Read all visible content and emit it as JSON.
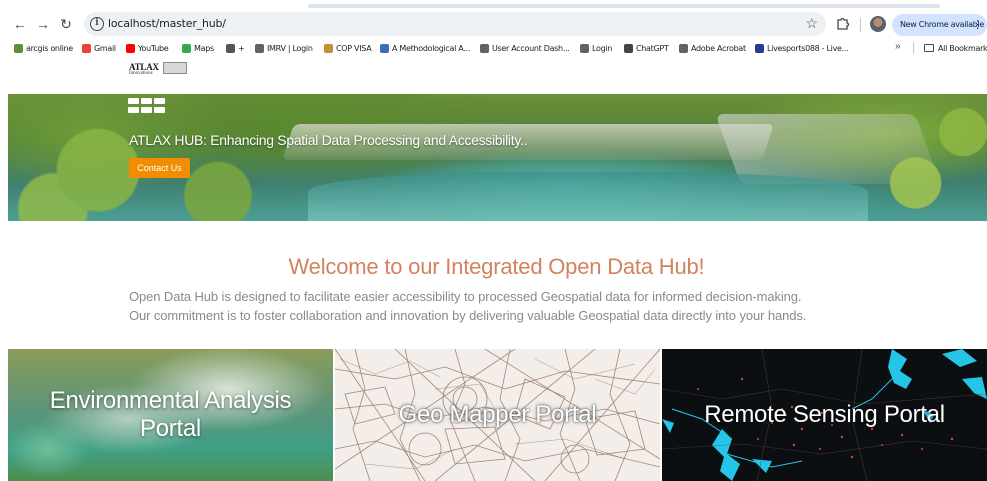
{
  "browser": {
    "url": "localhost/master_hub/",
    "update_label": "New Chrome available",
    "bookmarks": [
      {
        "label": "arcgis online",
        "color": "#5b8f3a"
      },
      {
        "label": "Gmail",
        "color": "#ea4335"
      },
      {
        "label": "YouTube",
        "color": "#ff0000"
      },
      {
        "label": "Maps",
        "color": "#34a853"
      },
      {
        "label": "+",
        "color": "#555555"
      },
      {
        "label": "IMRV | Login",
        "color": "#5f6368"
      },
      {
        "label": "COP VISA",
        "color": "#c58f3a"
      },
      {
        "label": "A Methodological A...",
        "color": "#3b6fb6"
      },
      {
        "label": "User Account Dash...",
        "color": "#5f6368"
      },
      {
        "label": "Login",
        "color": "#5f6368"
      },
      {
        "label": "ChatGPT",
        "color": "#444444"
      },
      {
        "label": "Adobe Acrobat",
        "color": "#5f6368"
      },
      {
        "label": "Livesports088 - Live...",
        "color": "#2a3b8f"
      }
    ],
    "all_bookmarks_label": "All Bookmarks"
  },
  "logo": {
    "name": "ATLAX",
    "sub": "Innovations"
  },
  "hero": {
    "title": "ATLAX HUB: Enhancing Spatial Data Processing and Accessibility..",
    "contact_label": "Contact Us"
  },
  "welcome": {
    "heading": "Welcome to our Integrated Open Data Hub!",
    "line1": "Open Data Hub is designed to facilitate easier accessibility to processed Geospatial data for informed decision-making.",
    "line2": "Our commitment is to foster collaboration and innovation by delivering valuable Geospatial data directly into your hands."
  },
  "portals": [
    {
      "line1": "Environmental Analysis",
      "line2": "Portal"
    },
    {
      "line1": "Geo Mapper Portal"
    },
    {
      "line1": "Remote Sensing Portal"
    }
  ],
  "colors": {
    "accent_orange": "#f28c00",
    "heading_salmon": "#d4825e",
    "body_grey": "#8a8a8a"
  }
}
